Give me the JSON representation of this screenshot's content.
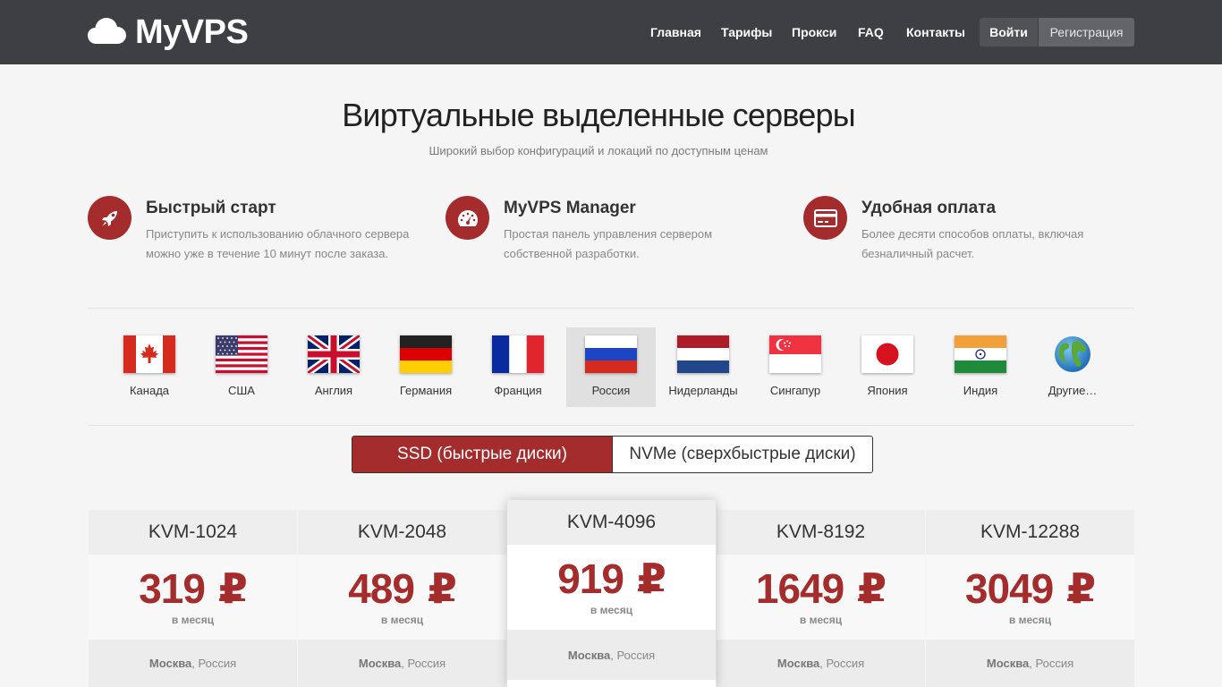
{
  "brand": {
    "name": "MyVPS",
    "logo_icon": "cloud-icon"
  },
  "nav": {
    "items": [
      "Главная",
      "Тарифы",
      "Прокси",
      "FAQ",
      "Контакты"
    ],
    "login": "Войти",
    "register": "Регистрация"
  },
  "hero": {
    "title": "Виртуальные выделенные серверы",
    "subtitle": "Широкий выбор конфигураций и локаций по доступным ценам"
  },
  "features": [
    {
      "icon": "rocket-icon",
      "title": "Быстрый старт",
      "desc": "Приступить к использованию облачного сервера можно уже в течение 10 минут после заказа."
    },
    {
      "icon": "dashboard-icon",
      "title": "MyVPS Manager",
      "desc": "Простая панель управления сервером собственной разработки."
    },
    {
      "icon": "credit-card-icon",
      "title": "Удобная оплата",
      "desc": "Более десяти способов оплаты, включая безналичный расчет."
    }
  ],
  "countries": [
    {
      "name": "Канада",
      "flag": "canada-flag-icon"
    },
    {
      "name": "США",
      "flag": "usa-flag-icon"
    },
    {
      "name": "Англия",
      "flag": "uk-flag-icon"
    },
    {
      "name": "Германия",
      "flag": "germany-flag-icon"
    },
    {
      "name": "Франция",
      "flag": "france-flag-icon"
    },
    {
      "name": "Россия",
      "flag": "russia-flag-icon",
      "selected": true
    },
    {
      "name": "Нидерланды",
      "flag": "netherlands-flag-icon"
    },
    {
      "name": "Сингапур",
      "flag": "singapore-flag-icon"
    },
    {
      "name": "Япония",
      "flag": "japan-flag-icon"
    },
    {
      "name": "Индия",
      "flag": "india-flag-icon"
    },
    {
      "name": "Другие…",
      "flag": "globe-icon"
    }
  ],
  "disk_toggle": {
    "ssd": "SSD (быстрые диски)",
    "nvme": "NVMe (сверхбыстрые диски)",
    "selected": "ssd"
  },
  "plans": [
    {
      "name": "KVM-1024",
      "price": "319",
      "currency": "₽",
      "period": "в месяц",
      "city": "Москва",
      "country": ", Россия"
    },
    {
      "name": "KVM-2048",
      "price": "489",
      "currency": "₽",
      "period": "в месяц",
      "city": "Москва",
      "country": ", Россия"
    },
    {
      "name": "KVM-4096",
      "price": "919",
      "currency": "₽",
      "period": "в месяц",
      "city": "Москва",
      "country": ", Россия",
      "featured": true
    },
    {
      "name": "KVM-8192",
      "price": "1649",
      "currency": "₽",
      "period": "в месяц",
      "city": "Москва",
      "country": ", Россия"
    },
    {
      "name": "KVM-12288",
      "price": "3049",
      "currency": "₽",
      "period": "в месяц",
      "city": "Москва",
      "country": ", Россия"
    }
  ],
  "colors": {
    "accent": "#a52c2c",
    "header_bg": "#3d3f42",
    "page_bg": "#f5f5f5"
  }
}
